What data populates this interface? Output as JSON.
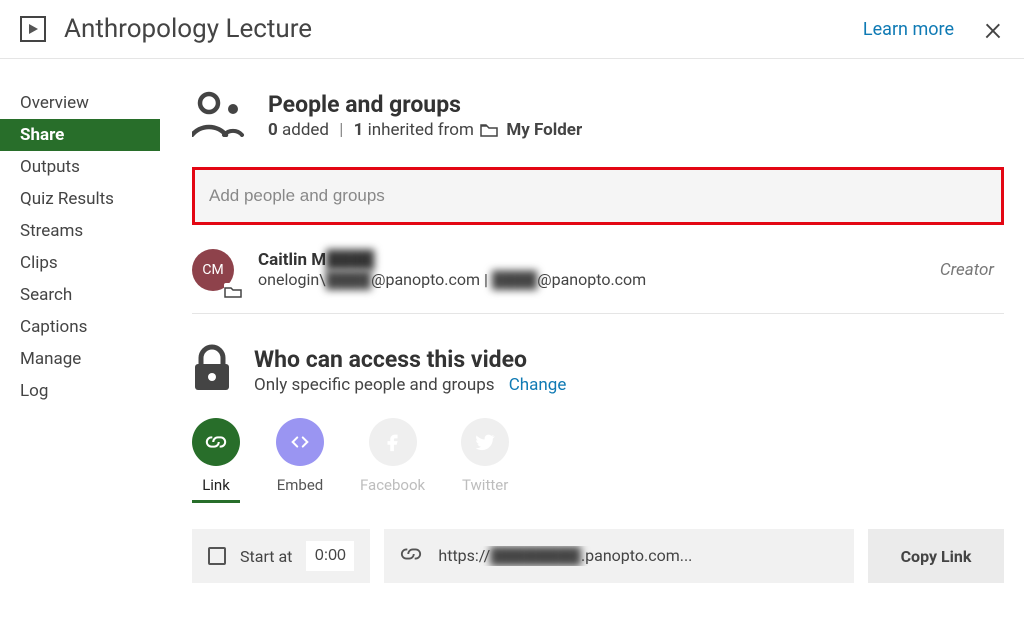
{
  "header": {
    "title": "Anthropology Lecture",
    "learn_more": "Learn more"
  },
  "sidebar": {
    "items": [
      {
        "id": "overview",
        "label": "Overview",
        "active": false
      },
      {
        "id": "share",
        "label": "Share",
        "active": true
      },
      {
        "id": "outputs",
        "label": "Outputs",
        "active": false
      },
      {
        "id": "quiz-results",
        "label": "Quiz Results",
        "active": false
      },
      {
        "id": "streams",
        "label": "Streams",
        "active": false
      },
      {
        "id": "clips",
        "label": "Clips",
        "active": false
      },
      {
        "id": "search",
        "label": "Search",
        "active": false
      },
      {
        "id": "captions",
        "label": "Captions",
        "active": false
      },
      {
        "id": "manage",
        "label": "Manage",
        "active": false
      },
      {
        "id": "log",
        "label": "Log",
        "active": false
      }
    ]
  },
  "people": {
    "title": "People and groups",
    "added_count": "0",
    "added_suffix": " added",
    "inherited_count": "1",
    "inherited_suffix": " inherited from",
    "folder_name": "My Folder",
    "input_placeholder": "Add people and groups",
    "user": {
      "initials": "CM",
      "name_prefix": "Caitlin M",
      "name_blur": "████",
      "detail_prefix": "onelogin\\",
      "detail_blur1": "████",
      "detail_at1": "@panopto.com | ",
      "detail_blur2": "████",
      "detail_at2": "@panopto.com",
      "role": "Creator"
    }
  },
  "access": {
    "title": "Who can access this video",
    "subtitle": "Only specific people and groups",
    "change": "Change",
    "options": [
      {
        "id": "link",
        "label": "Link",
        "active": true,
        "disabled": false
      },
      {
        "id": "embed",
        "label": "Embed",
        "active": false,
        "disabled": false
      },
      {
        "id": "fb",
        "label": "Facebook",
        "active": false,
        "disabled": true
      },
      {
        "id": "tw",
        "label": "Twitter",
        "active": false,
        "disabled": true
      }
    ],
    "start_at_label": "Start at",
    "start_at_value": "0:00",
    "url_prefix": "https://",
    "url_blur": "████████",
    "url_suffix": ".panopto.com...",
    "copy_label": "Copy Link"
  }
}
